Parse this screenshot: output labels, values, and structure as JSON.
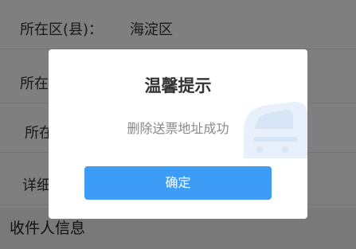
{
  "form": {
    "rows": [
      {
        "label": "所在区(县)：",
        "value": "海淀区"
      },
      {
        "label": "所在"
      },
      {
        "label": "所在"
      },
      {
        "label": "详细"
      }
    ]
  },
  "section": {
    "title": "收件人信息"
  },
  "dialog": {
    "title": "温馨提示",
    "message": "删除送票地址成功",
    "confirm_label": "确定",
    "decoration_icon": "train-icon"
  },
  "colors": {
    "accent": "#3c9cf6",
    "overlay": "rgba(0,0,0,0.5)"
  }
}
